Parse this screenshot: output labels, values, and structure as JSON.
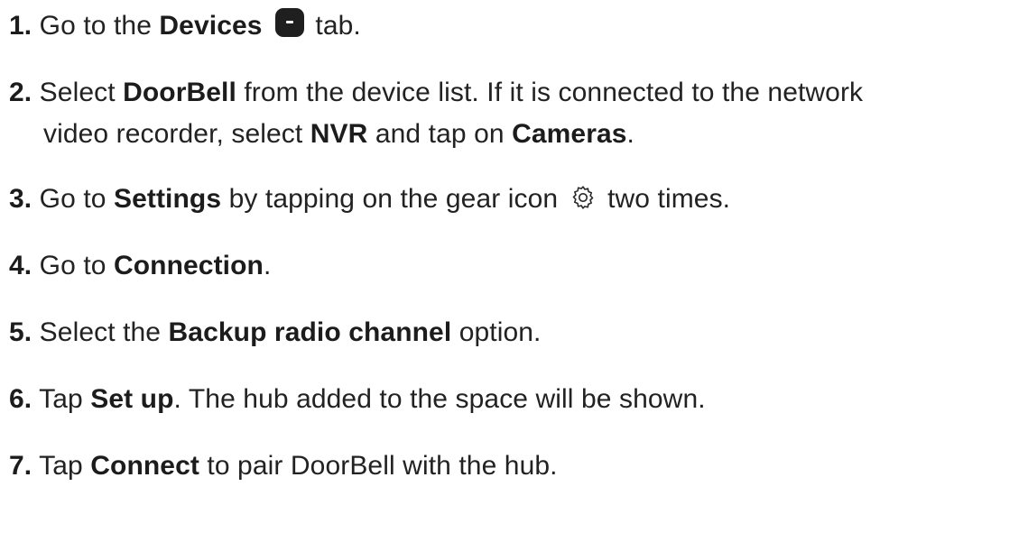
{
  "steps": [
    {
      "num": "1.",
      "parts": {
        "t1": "Go to the ",
        "b1": "Devices",
        "t2": " tab."
      },
      "icon": "devices-tab-icon"
    },
    {
      "num": "2.",
      "parts": {
        "t1": "Select ",
        "b1": "DoorBell",
        "t2": " from the device list. If it is connected to the network",
        "t3": "video recorder, select ",
        "b2": "NVR",
        "t4": " and tap on ",
        "b3": "Cameras",
        "t5": "."
      }
    },
    {
      "num": "3.",
      "parts": {
        "t1": "Go to ",
        "b1": "Settings",
        "t2": " by tapping on the gear icon",
        "t3": " two times."
      },
      "icon": "gear-icon"
    },
    {
      "num": "4.",
      "parts": {
        "t1": "Go to ",
        "b1": "Connection",
        "t2": "."
      }
    },
    {
      "num": "5.",
      "parts": {
        "t1": "Select the ",
        "b1": "Backup radio channel",
        "t2": " option."
      }
    },
    {
      "num": "6.",
      "parts": {
        "t1": "Tap ",
        "b1": "Set up",
        "t2": ". The hub added to the space will be shown."
      }
    },
    {
      "num": "7.",
      "parts": {
        "t1": "Tap ",
        "b1": "Connect",
        "t2": " to pair DoorBell with the hub."
      }
    }
  ]
}
